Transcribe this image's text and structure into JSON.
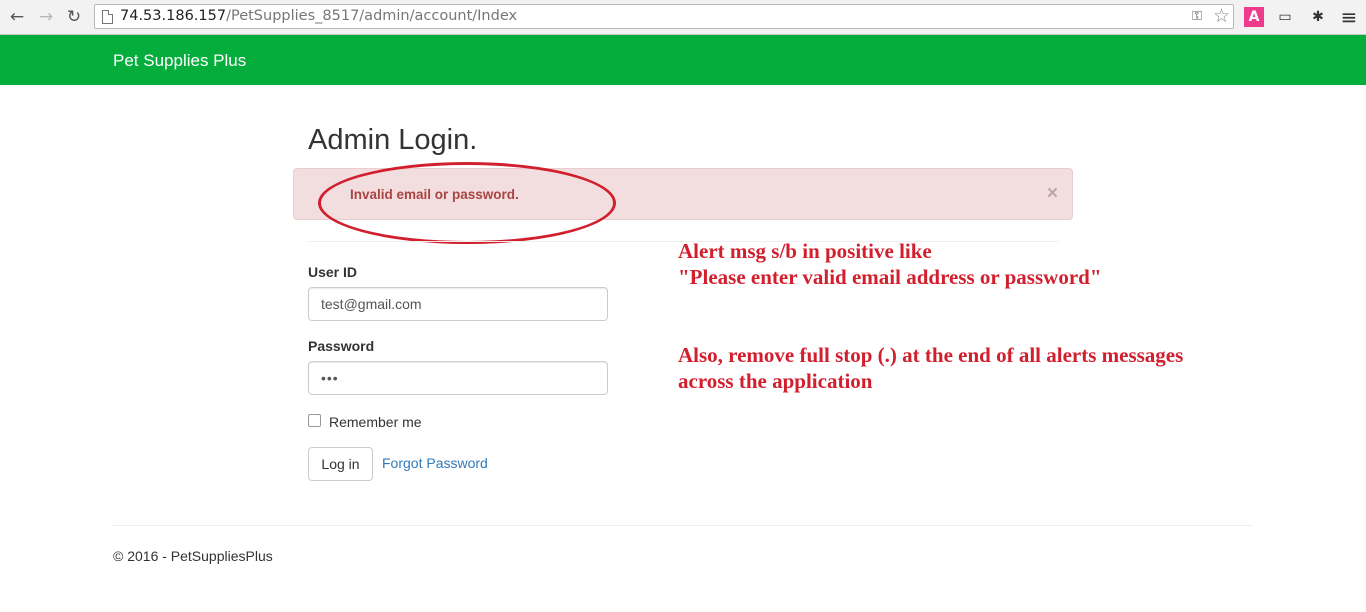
{
  "browser": {
    "back_icon": "←",
    "forward_icon": "→",
    "reload_icon": "↻",
    "url_host": "74.53.186.157",
    "url_path": "/PetSupplies_8517/admin/account/Index",
    "key_icon": "⚿",
    "star_icon": "☆",
    "ext_a_label": "A",
    "cast_icon": "▭",
    "bug_icon": "✱",
    "menu_icon": "≡"
  },
  "navbar": {
    "brand": "Pet Supplies Plus",
    "color": "#04ad3c"
  },
  "login": {
    "title": "Admin Login.",
    "alert_text": "Invalid email or password.",
    "alert_close": "×",
    "user_label": "User ID",
    "user_value": "test@gmail.com",
    "password_label": "Password",
    "password_value": "•••",
    "remember_label": "Remember me",
    "remember_checked": false,
    "login_button": "Log in",
    "forgot_link": "Forgot Password"
  },
  "annotation": {
    "color": "#d11f2e",
    "note1_line1": "Alert msg s/b in positive like",
    "note1_line2": "\"Please enter valid email address or password\"",
    "note2_line1": "Also, remove full stop (.) at the end of all alerts messages",
    "note2_line2": "across the application"
  },
  "footer": {
    "text": "© 2016 - PetSuppliesPlus"
  }
}
